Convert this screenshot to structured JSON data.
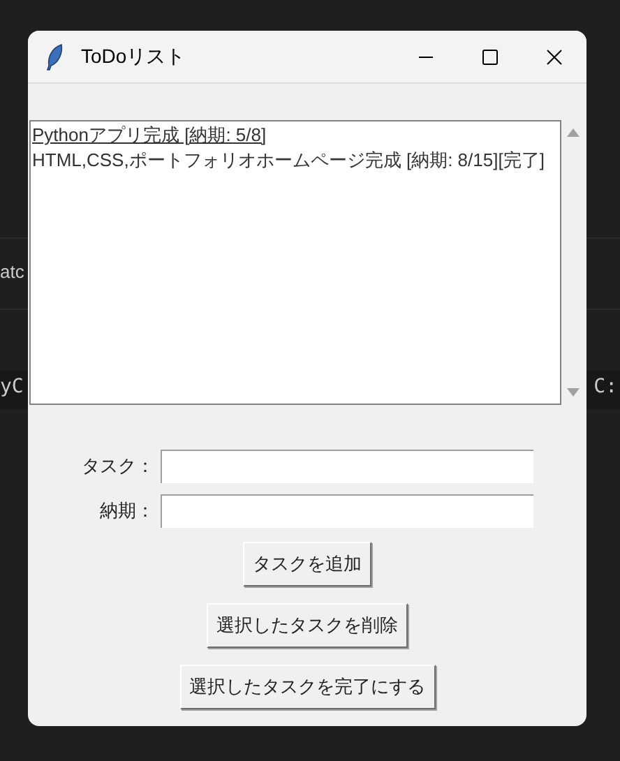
{
  "background": {
    "texts": [
      {
        "kind": "label",
        "text": "atc"
      },
      {
        "kind": "terminal-left",
        "text": "yC"
      },
      {
        "kind": "terminal-right",
        "text": "C:"
      }
    ]
  },
  "window": {
    "title": "ToDoリスト"
  },
  "tasks": [
    {
      "text": "Pythonアプリ完成 [納期: 5/8]",
      "active": true
    },
    {
      "text": "HTML,CSS,ポートフォリオホームページ完成 [納期: 8/15][完了]",
      "active": false
    }
  ],
  "form": [
    {
      "label": "タスク："
    },
    {
      "label": "納期："
    }
  ],
  "buttons": [
    "タスクを追加",
    "選択したタスクを削除",
    "選択したタスクを完了にする"
  ]
}
